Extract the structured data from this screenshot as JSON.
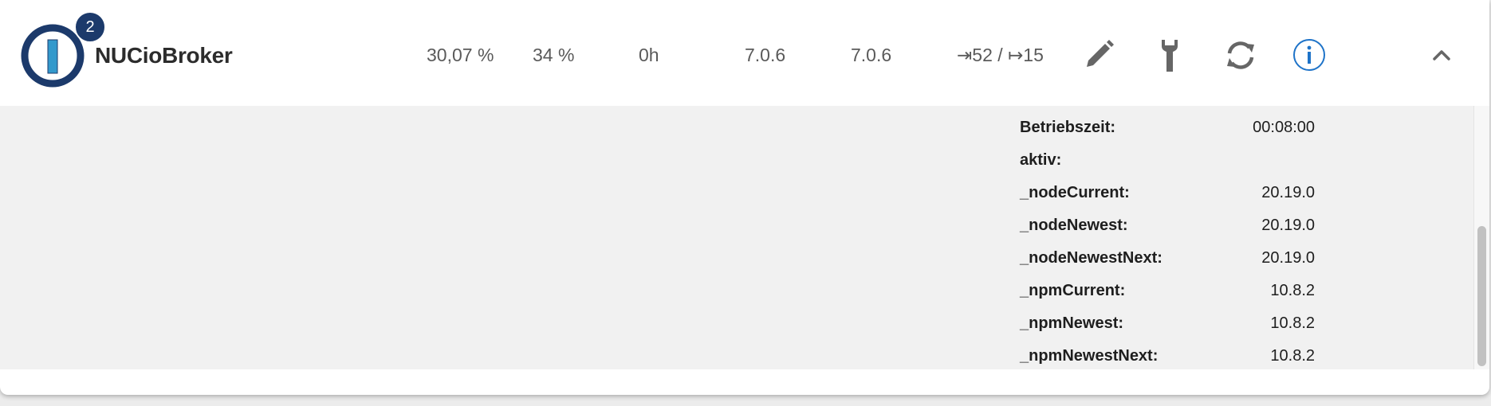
{
  "host": {
    "name": "NUCioBroker",
    "badge_count": "2"
  },
  "stats": {
    "cpu": "30,07 %",
    "memory": "34 %",
    "uptime": "0h",
    "js_controller_version": "7.0.6",
    "js_controller_installed": "7.0.6",
    "events": "⇥52 / ↦15"
  },
  "actions": {
    "edit_icon": "pencil-icon",
    "settings_icon": "wrench-icon",
    "restart_icon": "refresh-icon",
    "info_icon": "info-icon",
    "collapse_icon": "chevron-up-icon"
  },
  "details": [
    {
      "key": "Betriebszeit:",
      "value": "00:08:00"
    },
    {
      "key": "aktiv:",
      "value": ""
    },
    {
      "key": "_nodeCurrent:",
      "value": "20.19.0"
    },
    {
      "key": "_nodeNewest:",
      "value": "20.19.0"
    },
    {
      "key": "_nodeNewestNext:",
      "value": "20.19.0"
    },
    {
      "key": "_npmCurrent:",
      "value": "10.8.2"
    },
    {
      "key": "_npmNewest:",
      "value": "10.8.2"
    },
    {
      "key": "_npmNewestNext:",
      "value": "10.8.2"
    }
  ],
  "colors": {
    "brand_dark": "#1c3a6b",
    "brand_light": "#3399cc",
    "icon_gray": "#666666",
    "info_blue": "#1e73c8"
  }
}
